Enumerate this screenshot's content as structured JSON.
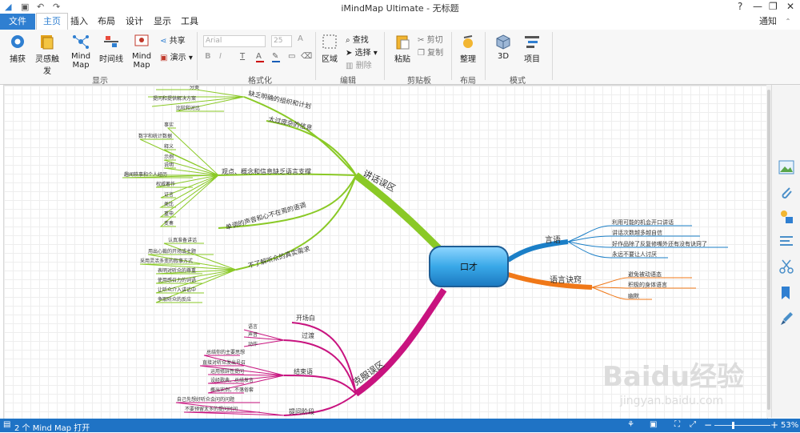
{
  "window": {
    "title": "iMindMap Ultimate - 无标题",
    "notify_label": "通知"
  },
  "tabs": [
    {
      "label": "文件"
    },
    {
      "label": "主页"
    },
    {
      "label": "插入"
    },
    {
      "label": "布局"
    },
    {
      "label": "设计"
    },
    {
      "label": "显示"
    },
    {
      "label": "工具"
    }
  ],
  "ribbon": {
    "capture": "捕获",
    "inspiration": "灵感触发",
    "mindmap1": "Mind Map",
    "timeline": "时间线",
    "mindmap2": "Mind Map",
    "share": "共享",
    "present": "演示",
    "group_display": "显示",
    "group_format": "格式化",
    "font_name": "Arial",
    "font_size": "25",
    "select_box": "区域",
    "find": "查找",
    "select": "选择",
    "delete": "删除",
    "group_edit": "编辑",
    "paste": "粘贴",
    "cut": "剪切",
    "copy": "复制",
    "group_clipboard": "剪贴板",
    "arrange": "整理",
    "group_layout": "布局",
    "view3d": "3D",
    "project": "项目",
    "group_mode": "模式"
  },
  "mindmap": {
    "central": "口才",
    "b1": "讲话误区",
    "b1_sub": [
      "缺乏明确的组织和计划",
      "太过庞杂的信息",
      "观点、概念和信息缺乏语言支撑",
      "单调的声音和心不在焉的语调",
      "不了解听众的真实需求"
    ],
    "b1_s1_leaves": [
      "分类",
      "提问和提供解决方案",
      "比较和对比"
    ],
    "b1_s3_leaves": [
      "事实",
      "数字和统计数据",
      "释义",
      "示例",
      "说明",
      "趣闻轶事和个人经历",
      "权威著作",
      "证言",
      "类比",
      "重申",
      "变奏"
    ],
    "b1_s5_leaves": [
      "认真准备讲话",
      "用出心裁的开场或主题",
      "采用灵活多变的叙事方式",
      "表明对听众的尊重",
      "使用感召力的词语",
      "让听众介入讲话中",
      "争取听众的反应"
    ],
    "b2": "言语",
    "b2_leaves": [
      "利用可能的机会开口讲话",
      "讲话次数越多越自信",
      "好作品除了反复修嘴外还有没有诀窍了",
      "永远不要让人讨厌"
    ],
    "b3": "语言诀窍",
    "b3_leaves": [
      "避免被动语态",
      "积极的身体语言",
      "幽默"
    ],
    "b4": "克服误区",
    "b4_sub": [
      "开场白",
      "过渡",
      "结束语",
      "提问阶段"
    ],
    "b4_s2_leaves": [
      "语言",
      "声音",
      "动作"
    ],
    "b4_s3_leaves": [
      "总结你的主要思想",
      "直接对听众发出号召",
      "运用修辞性提问",
      "设经歌典，总结发言",
      "概出实例，不落俗套"
    ],
    "b4_s4_leaves": [
      "自己先想好听众会问的问题",
      "不要预留太多的提问时间"
    ]
  },
  "watermark": {
    "brand": "Baidu经验",
    "url": "jingyan.baidu.com"
  },
  "status": {
    "open_maps": "2 个 Mind Map 打开",
    "zoom": "53%"
  },
  "colors": {
    "accent": "#2f7fd1",
    "green_branch": "#8ac926",
    "blue_branch": "#1b7fc7",
    "orange_branch": "#f07818",
    "magenta_branch": "#c8137f",
    "central_fill": "#39a8e8"
  }
}
